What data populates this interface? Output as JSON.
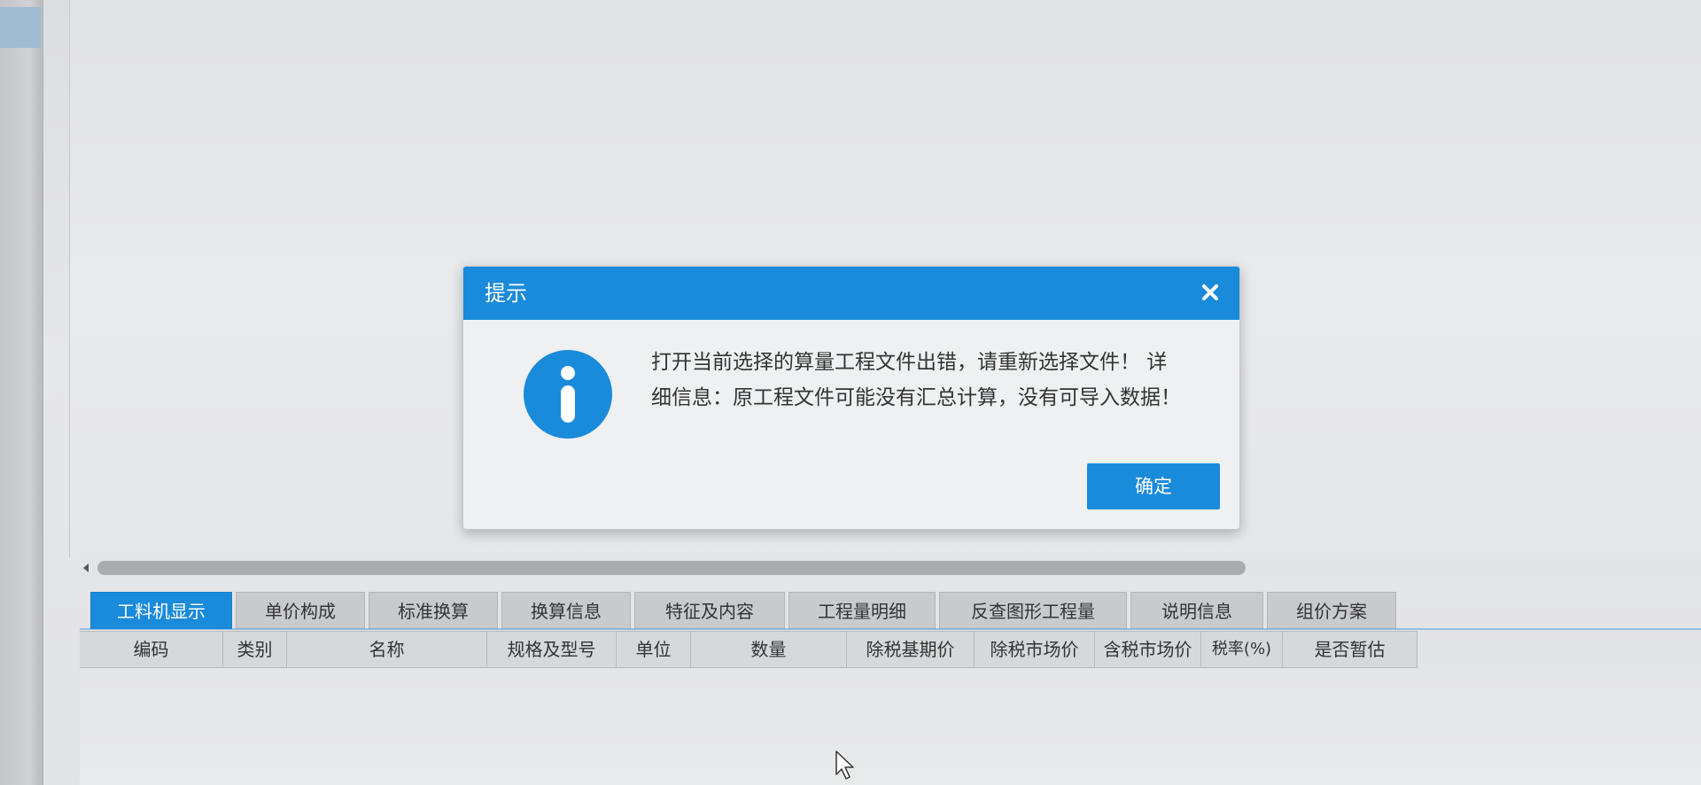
{
  "dialog": {
    "title": "提示",
    "message": "打开当前选择的算量工程文件出错，请重新选择文件！ 详细信息：原工程文件可能没有汇总计算，没有可导入数据！",
    "ok_label": "确定",
    "close_icon": "close-icon",
    "info_icon": "info-icon",
    "accent_color": "#1a8adb"
  },
  "tabs": [
    {
      "label": "工料机显示",
      "active": true
    },
    {
      "label": "单价构成",
      "active": false
    },
    {
      "label": "标准换算",
      "active": false
    },
    {
      "label": "换算信息",
      "active": false
    },
    {
      "label": "特征及内容",
      "active": false
    },
    {
      "label": "工程量明细",
      "active": false
    },
    {
      "label": "反查图形工程量",
      "active": false
    },
    {
      "label": "说明信息",
      "active": false
    },
    {
      "label": "组价方案",
      "active": false
    }
  ],
  "grid": {
    "columns": [
      "编码",
      "类别",
      "名称",
      "规格及型号",
      "单位",
      "数量",
      "除税基期价",
      "除税市场价",
      "含税市场价",
      "税率(%)",
      "是否暂估"
    ]
  }
}
